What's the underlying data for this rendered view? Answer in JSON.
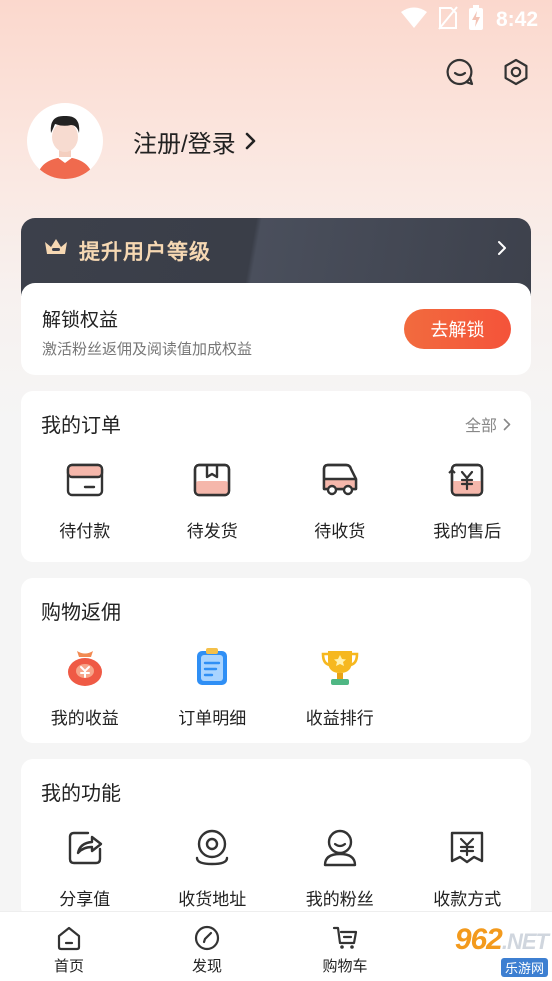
{
  "status_bar": {
    "time": "8:42"
  },
  "profile": {
    "login_label": "注册/登录"
  },
  "vip": {
    "title": "提升用户等级",
    "unlock_title": "解锁权益",
    "unlock_desc": "激活粉丝返佣及阅读值加成权益",
    "unlock_button": "去解锁"
  },
  "orders": {
    "title": "我的订单",
    "more_label": "全部",
    "items": [
      {
        "label": "待付款",
        "icon": "wallet-icon"
      },
      {
        "label": "待发货",
        "icon": "package-icon"
      },
      {
        "label": "待收货",
        "icon": "truck-icon"
      },
      {
        "label": "我的售后",
        "icon": "refund-icon"
      }
    ]
  },
  "rebate": {
    "title": "购物返佣",
    "items": [
      {
        "label": "我的收益",
        "icon": "money-bag-icon"
      },
      {
        "label": "订单明细",
        "icon": "clipboard-icon"
      },
      {
        "label": "收益排行",
        "icon": "trophy-icon"
      }
    ]
  },
  "features": {
    "title": "我的功能",
    "items": [
      {
        "label": "分享值",
        "icon": "share-icon"
      },
      {
        "label": "收货地址",
        "icon": "location-icon"
      },
      {
        "label": "我的粉丝",
        "icon": "fans-icon"
      },
      {
        "label": "收款方式",
        "icon": "payment-icon"
      }
    ]
  },
  "tabbar": {
    "items": [
      {
        "label": "首页",
        "icon": "home-icon"
      },
      {
        "label": "发现",
        "icon": "compass-icon"
      },
      {
        "label": "购物车",
        "icon": "cart-icon"
      }
    ]
  },
  "watermark": {
    "brand": "962",
    "suffix": ".NET",
    "sub": "乐游网"
  },
  "colors": {
    "accent": "#f4583b",
    "vip_gold": "#f6d8b3",
    "vip_dark": "#3c404b"
  }
}
